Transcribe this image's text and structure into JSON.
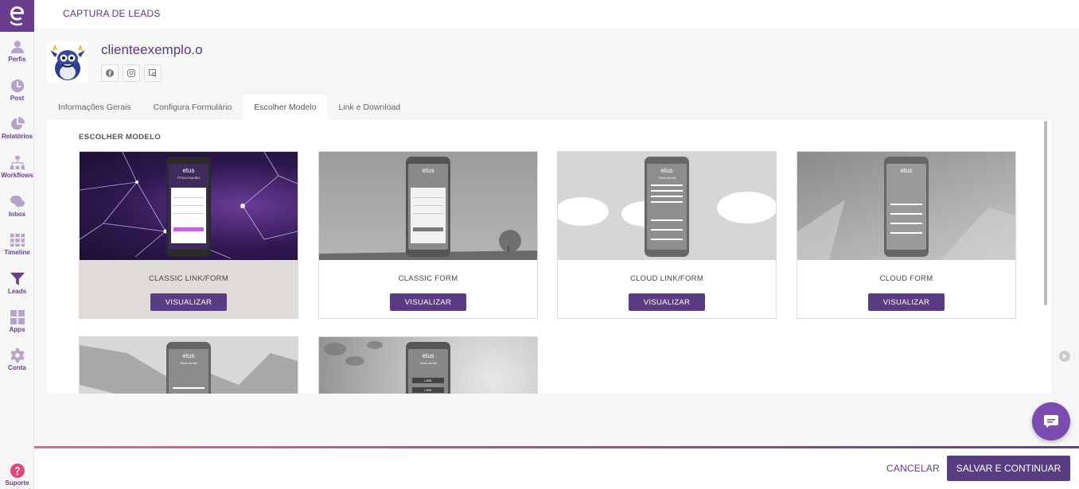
{
  "header": {
    "title": "CAPTURA DE LEADS"
  },
  "sidebar": {
    "items": [
      {
        "label": "Perfis",
        "icon": "user-icon"
      },
      {
        "label": "Post",
        "icon": "clock-icon"
      },
      {
        "label": "Relatórios",
        "icon": "pie-chart-icon"
      },
      {
        "label": "Workflows",
        "icon": "workflow-icon"
      },
      {
        "label": "Inbox",
        "icon": "chat-bubbles-icon"
      },
      {
        "label": "Timeline",
        "icon": "grid-icon"
      },
      {
        "label": "Leads",
        "icon": "funnel-icon"
      },
      {
        "label": "Apps",
        "icon": "apps-icon"
      },
      {
        "label": "Conta",
        "icon": "gear-icon"
      },
      {
        "label": "Suporte",
        "icon": "help-icon"
      }
    ]
  },
  "profile": {
    "name": "clienteexemplo.o"
  },
  "tabs": [
    {
      "label": "Informações Gerais"
    },
    {
      "label": "Configura Formulário"
    },
    {
      "label": "Escolher Modelo"
    },
    {
      "label": "Link e Download"
    }
  ],
  "active_tab": "Escolher Modelo",
  "section": {
    "title": "ESCOLHER MODELO"
  },
  "templates": [
    {
      "title": "CLASSIC LINK/FORM",
      "button": "VISUALIZAR",
      "selected": true
    },
    {
      "title": "CLASSIC FORM",
      "button": "VISUALIZAR"
    },
    {
      "title": "CLOUD LINK/FORM",
      "button": "VISUALIZAR"
    },
    {
      "title": "CLOUD FORM",
      "button": "VISUALIZAR"
    }
  ],
  "mock": {
    "brand": "etus",
    "t1_sub": "TÍTULO DA BIO",
    "t3_sub": "Título da bio",
    "t5_sub": "Título da bio",
    "t6_sub": "Título da bio",
    "link": "LINK"
  },
  "footer": {
    "cancel": "CANCELAR",
    "save": "SALVAR E CONTINUAR"
  },
  "colors": {
    "primary": "#5a3c82",
    "accent": "#e0689b",
    "sidebar_icon": "#b6a4c9"
  }
}
